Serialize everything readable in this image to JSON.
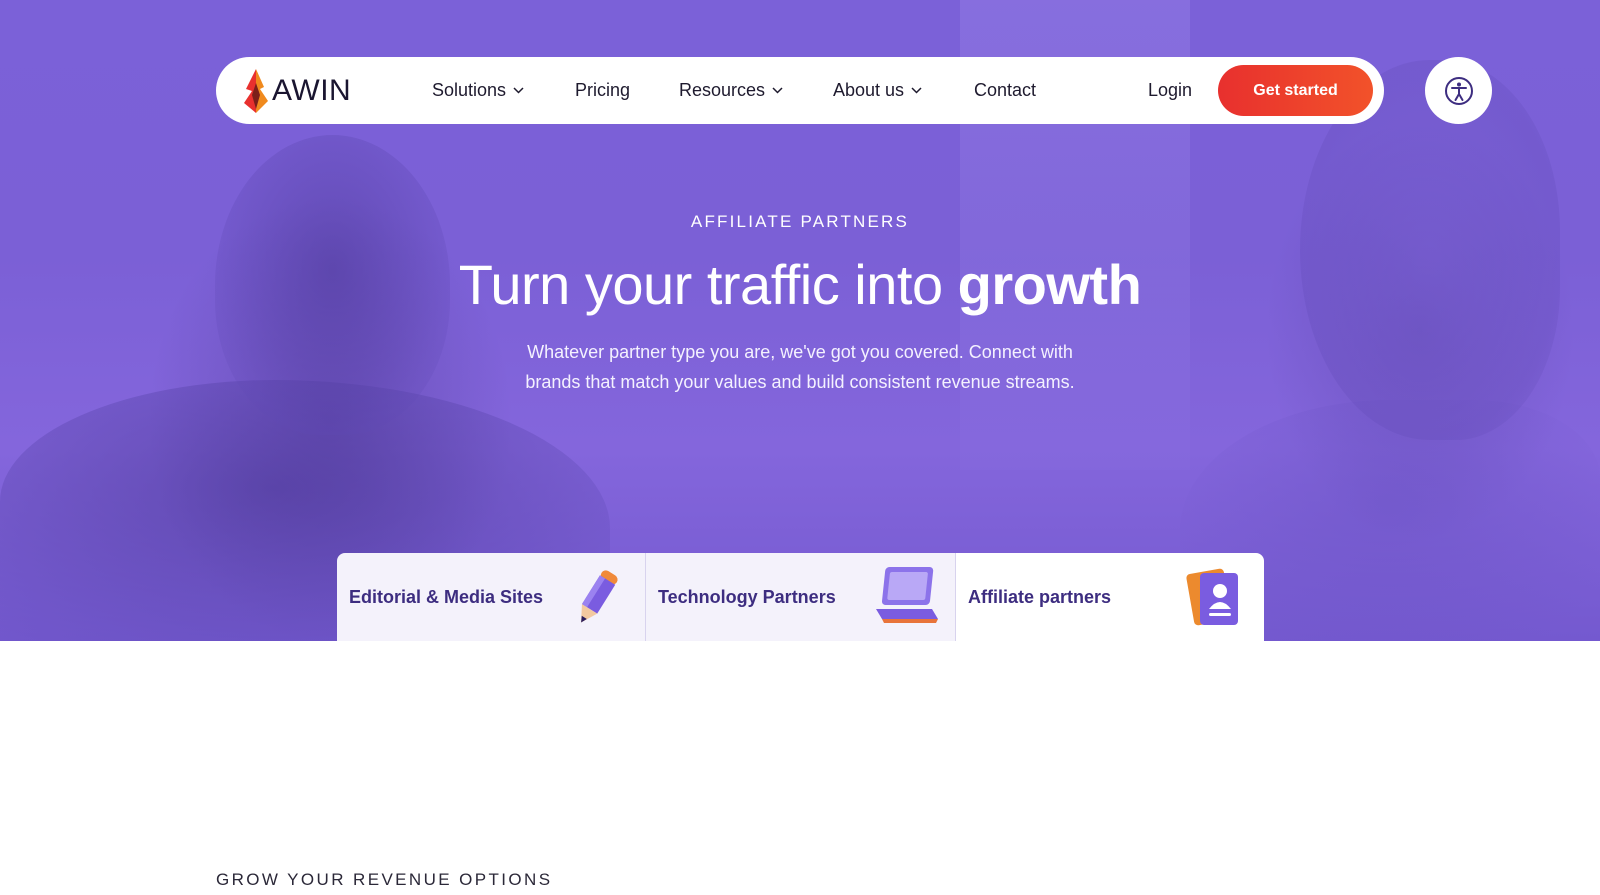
{
  "brand": {
    "name": "AWIN",
    "accent": "#e8302e",
    "hero_color": "#7b61d8"
  },
  "nav": {
    "items": [
      {
        "label": "Solutions",
        "has_dropdown": true
      },
      {
        "label": "Pricing",
        "has_dropdown": false
      },
      {
        "label": "Resources",
        "has_dropdown": true
      },
      {
        "label": "About us",
        "has_dropdown": true
      },
      {
        "label": "Contact",
        "has_dropdown": false
      }
    ],
    "login": "Login",
    "cta": "Get started",
    "accessibility_icon": "accessibility-icon"
  },
  "hero": {
    "eyebrow": "AFFILIATE PARTNERS",
    "headline_regular": "Turn your traffic into ",
    "headline_bold": "growth",
    "subtext": "Whatever partner type you are, we've got you covered. Connect with brands that match your values and build consistent revenue streams."
  },
  "tabs": [
    {
      "label": "Editorial & Media Sites",
      "icon": "pencil-icon",
      "active": false
    },
    {
      "label": "Technology Partners",
      "icon": "laptop-icon",
      "active": false
    },
    {
      "label": "Affiliate partners",
      "icon": "id-card-icon",
      "active": true
    }
  ],
  "section": {
    "eyebrow": "GROW YOUR REVENUE OPTIONS"
  }
}
